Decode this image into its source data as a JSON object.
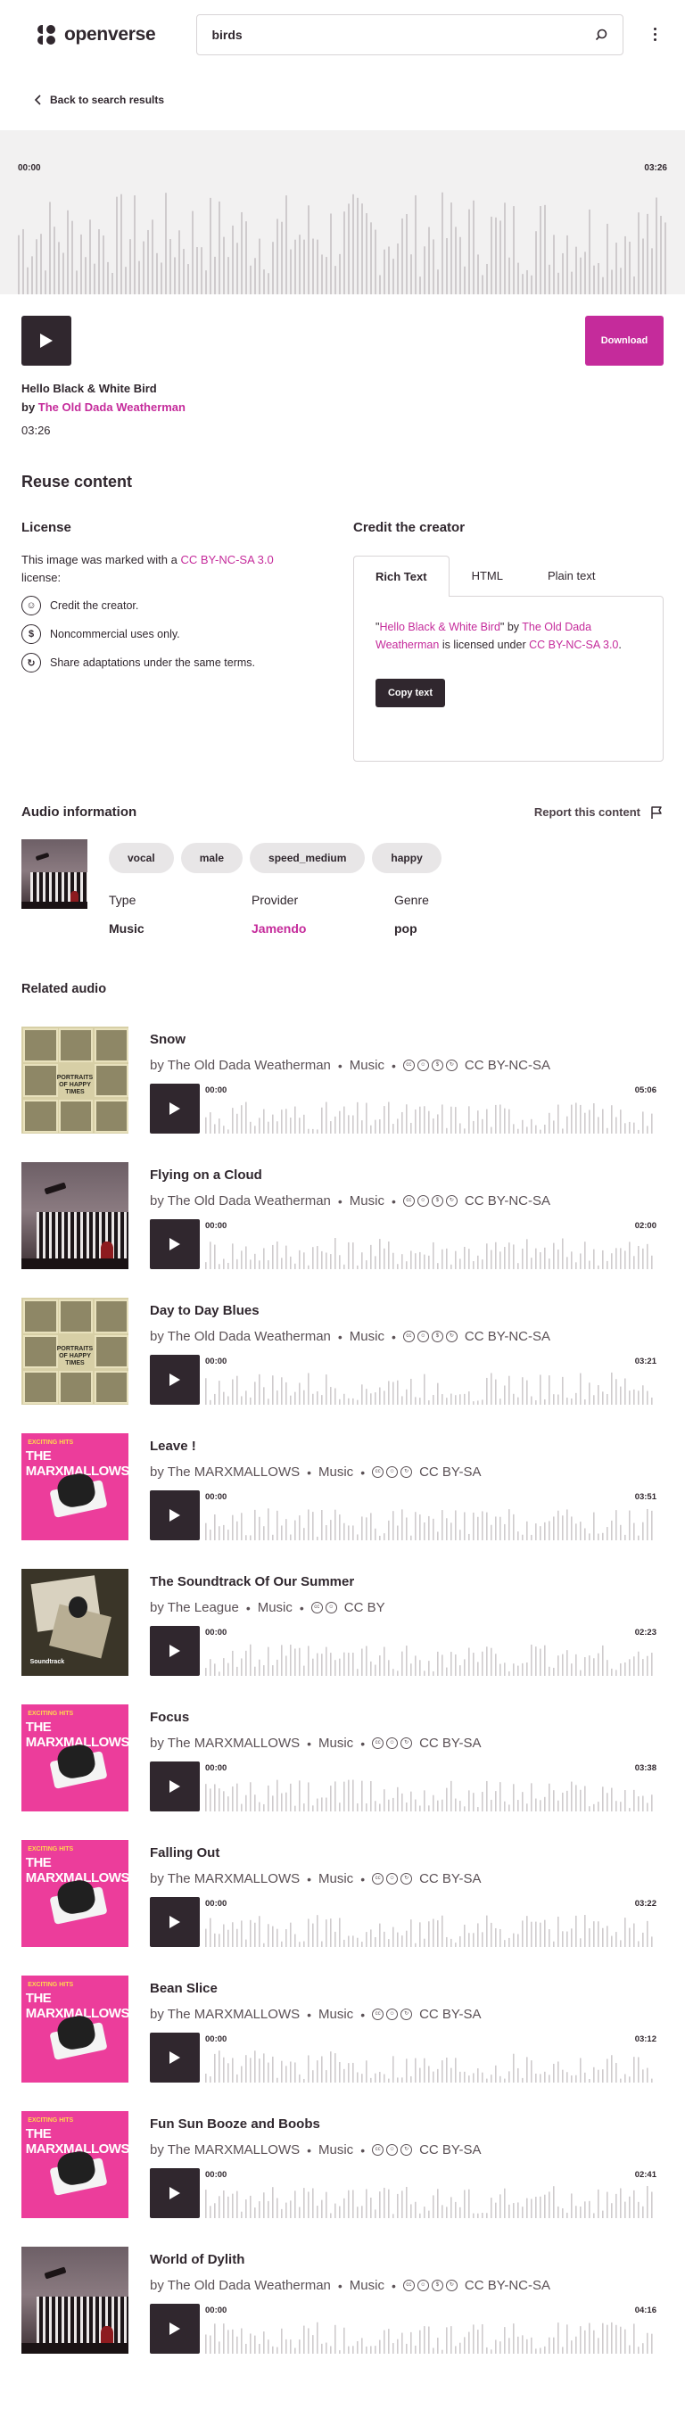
{
  "header": {
    "logo_text": "openverse",
    "search_value": "birds"
  },
  "back_link": "Back to search results",
  "player": {
    "start_time": "00:00",
    "end_time": "03:26",
    "download_label": "Download"
  },
  "track": {
    "title": "Hello Black & White Bird",
    "by_prefix": "by",
    "artist": "The Old Dada Weatherman",
    "duration": "03:26"
  },
  "reuse": {
    "heading": "Reuse content",
    "license_heading": "License",
    "license_desc_prefix": "This image was marked with a ",
    "license_name": "CC BY-NC-SA 3.0",
    "license_desc_suffix": " license:",
    "terms": [
      {
        "icon": "by-icon",
        "glyph": "☺",
        "text": "Credit the creator."
      },
      {
        "icon": "nc-icon",
        "glyph": "$",
        "text": "Noncommercial uses only."
      },
      {
        "icon": "sa-icon",
        "glyph": "↻",
        "text": "Share adaptations under the same terms."
      }
    ],
    "credit_heading": "Credit the creator",
    "tabs": [
      "Rich Text",
      "HTML",
      "Plain text"
    ],
    "credit_quote_open": "\"",
    "credit_title": "Hello Black & White Bird",
    "credit_quote_close": "\" by ",
    "credit_artist": "The Old Dada Weatherman",
    "credit_mid": " is licensed under ",
    "credit_license": "CC BY-NC-SA 3.0",
    "credit_end": ".",
    "copy_label": "Copy text"
  },
  "audio_info": {
    "heading": "Audio information",
    "report_label": "Report this content",
    "tags": [
      "vocal",
      "male",
      "speed_medium",
      "happy"
    ],
    "type_label": "Type",
    "type_value": "Music",
    "provider_label": "Provider",
    "provider_value": "Jamendo",
    "genre_label": "Genre",
    "genre_value": "pop"
  },
  "related": {
    "heading": "Related audio",
    "items": [
      {
        "title": "Snow",
        "by": "by The Old Dada Weatherman",
        "category": "Music",
        "license": "CC BY-NC-SA",
        "icons": [
          "cc",
          "by",
          "nc",
          "sa"
        ],
        "start": "00:00",
        "end": "05:06",
        "art": "portraits"
      },
      {
        "title": "Flying on a Cloud",
        "by": "by The Old Dada Weatherman",
        "category": "Music",
        "license": "CC BY-NC-SA",
        "icons": [
          "cc",
          "by",
          "nc",
          "sa"
        ],
        "start": "00:00",
        "end": "02:00",
        "art": "dada"
      },
      {
        "title": "Day to Day Blues",
        "by": "by The Old Dada Weatherman",
        "category": "Music",
        "license": "CC BY-NC-SA",
        "icons": [
          "cc",
          "by",
          "nc",
          "sa"
        ],
        "start": "00:00",
        "end": "03:21",
        "art": "portraits"
      },
      {
        "title": "Leave !",
        "by": "by The MARXMALLOWS",
        "category": "Music",
        "license": "CC BY-SA",
        "icons": [
          "cc",
          "by",
          "sa"
        ],
        "start": "00:00",
        "end": "03:51",
        "art": "marx"
      },
      {
        "title": "The Soundtrack Of Our Summer",
        "by": "by The League",
        "category": "Music",
        "license": "CC BY",
        "icons": [
          "cc",
          "by"
        ],
        "start": "00:00",
        "end": "02:23",
        "art": "league"
      },
      {
        "title": "Focus",
        "by": "by The MARXMALLOWS",
        "category": "Music",
        "license": "CC BY-SA",
        "icons": [
          "cc",
          "by",
          "sa"
        ],
        "start": "00:00",
        "end": "03:38",
        "art": "marx"
      },
      {
        "title": "Falling Out",
        "by": "by The MARXMALLOWS",
        "category": "Music",
        "license": "CC BY-SA",
        "icons": [
          "cc",
          "by",
          "sa"
        ],
        "start": "00:00",
        "end": "03:22",
        "art": "marx"
      },
      {
        "title": "Bean Slice",
        "by": "by The MARXMALLOWS",
        "category": "Music",
        "license": "CC BY-SA",
        "icons": [
          "cc",
          "by",
          "sa"
        ],
        "start": "00:00",
        "end": "03:12",
        "art": "marx"
      },
      {
        "title": "Fun Sun Booze and Boobs",
        "by": "by The MARXMALLOWS",
        "category": "Music",
        "license": "CC BY-SA",
        "icons": [
          "cc",
          "by",
          "sa"
        ],
        "start": "00:00",
        "end": "02:41",
        "art": "marx"
      },
      {
        "title": "World of Dylith",
        "by": "by The Old Dada Weatherman",
        "category": "Music",
        "license": "CC BY-NC-SA",
        "icons": [
          "cc",
          "by",
          "nc",
          "sa"
        ],
        "start": "00:00",
        "end": "04:16",
        "art": "dada"
      }
    ]
  },
  "art_text": {
    "portraits": "PORTRAITS OF HAPPY TIMES",
    "marx_top": "EXCITING HITS",
    "marx_name": "THE MARXMALLOWS",
    "league": "Soundtrack"
  },
  "colors": {
    "accent": "#c52b9b",
    "dark": "#30272e",
    "wave_bar": "#cfcbcd",
    "banner_bg": "#f2f1f1"
  }
}
